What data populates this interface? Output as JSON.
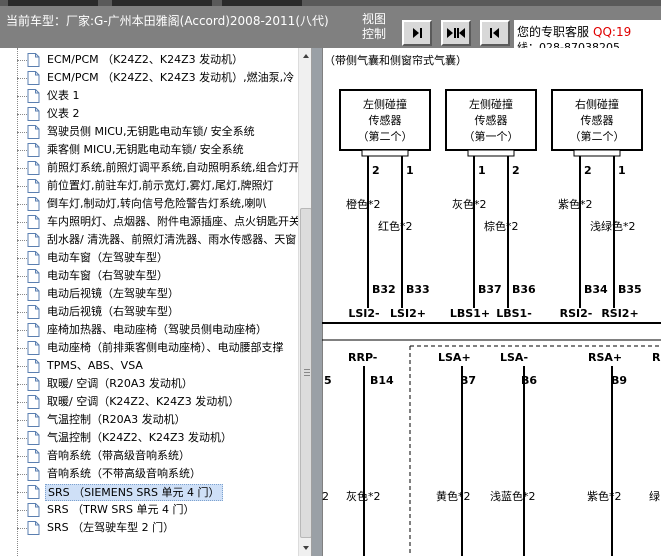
{
  "header": {
    "car_model": "当前车型：厂家:G-广州本田雅阁(Accord)2008-2011(八代)",
    "view_control": "视图控制",
    "service_label": "您的专职客服",
    "service_qq": "QQ:19",
    "service_phone": "线：028-87038205",
    "buttons": [
      {
        "name": "prev-page-button",
        "icon": "arrow-left-bar-icon"
      },
      {
        "name": "fit-page-button",
        "icon": "arrows-in-icon"
      },
      {
        "name": "next-page-button",
        "icon": "arrow-right-bar-icon"
      }
    ]
  },
  "tree": {
    "items": [
      {
        "label": "ECM/PCM （K24Z2、K24Z3 发动机）"
      },
      {
        "label": "ECM/PCM （K24Z2、K24Z3 发动机）,燃油泵,冷"
      },
      {
        "label": "仪表 1"
      },
      {
        "label": "仪表 2"
      },
      {
        "label": "驾驶员侧 MICU,无钥匙电动车锁/ 安全系统"
      },
      {
        "label": "乘客侧 MICU,无钥匙电动车锁/ 安全系统"
      },
      {
        "label": "前照灯系统,前照灯调平系统,自动照明系统,组合灯开"
      },
      {
        "label": "前位置灯,前驻车灯,前示宽灯,雾灯,尾灯,牌照灯"
      },
      {
        "label": "倒车灯,制动灯,转向信号危险警告灯系统,喇叭"
      },
      {
        "label": "车内照明灯、点烟器、附件电源插座、点火钥匙开关"
      },
      {
        "label": "刮水器/ 清洗器、前照灯清洗器、雨水传感器、天窗"
      },
      {
        "label": "电动车窗（左驾驶车型）"
      },
      {
        "label": "电动车窗（右驾驶车型）"
      },
      {
        "label": "电动后视镜（左驾驶车型）"
      },
      {
        "label": "电动后视镜（右驾驶车型）"
      },
      {
        "label": "座椅加热器、电动座椅（驾驶员侧电动座椅）"
      },
      {
        "label": "电动座椅（前排乘客侧电动座椅）、电动腰部支撑"
      },
      {
        "label": "TPMS、ABS、VSA"
      },
      {
        "label": "取暖/ 空调（R20A3 发动机）"
      },
      {
        "label": "取暖/ 空调（K24Z2、K24Z3 发动机）"
      },
      {
        "label": "气温控制（R20A3 发动机）"
      },
      {
        "label": "气温控制（K24Z2、K24Z3 发动机）"
      },
      {
        "label": "音响系统（带高级音响系统）"
      },
      {
        "label": "音响系统（不带高级音响系统）"
      },
      {
        "label": "SRS （SIEMENS SRS 单元 4 门）",
        "selected": true
      },
      {
        "label": "SRS （TRW SRS 单元 4 门）"
      },
      {
        "label": "SRS （左驾驶车型 2 门）"
      }
    ]
  },
  "diagram": {
    "caption": "（带侧气囊和侧窗帘式气囊）",
    "sensors": [
      {
        "line1": "左侧碰撞",
        "line2": "传感器",
        "line3": "（第二个）",
        "pin_a": "2",
        "pin_b": "1",
        "color_a": "橙色*2",
        "color_b": "红色*2",
        "term_a": "B32",
        "term_b": "B33",
        "bus_a": "LSI2-",
        "bus_b": "LSI2+"
      },
      {
        "line1": "左侧碰撞",
        "line2": "传感器",
        "line3": "（第一个）",
        "pin_a": "1",
        "pin_b": "2",
        "color_a": "灰色*2",
        "color_b": "棕色*2",
        "term_a": "B37",
        "term_b": "B36",
        "bus_a": "LBS1+",
        "bus_b": "LBS1-"
      },
      {
        "line1": "右侧碰撞",
        "line2": "传感器",
        "line3": "（第二个）",
        "pin_a": "2",
        "pin_b": "1",
        "color_a": "紫色*2",
        "color_b": "浅绿色*2",
        "term_a": "B34",
        "term_b": "B35",
        "bus_a": "RSI2-",
        "bus_b": "RSI2+"
      }
    ],
    "lower": {
      "rrp_label": "RRP-",
      "rrp_pin": "B14",
      "left_pin": "5",
      "left_color": "灰色*2",
      "edge_mark": "2",
      "lsa_plus": "LSA+",
      "lsa_minus": "LSA-",
      "rsa_plus": "RSA+",
      "right_edge_label": "R",
      "pins": [
        {
          "term": "B7",
          "color": "黄色*2"
        },
        {
          "term": "B6",
          "color": "浅蓝色*2"
        },
        {
          "term": "B9",
          "color": "紫色*2"
        }
      ],
      "edge_color": "绿"
    }
  }
}
